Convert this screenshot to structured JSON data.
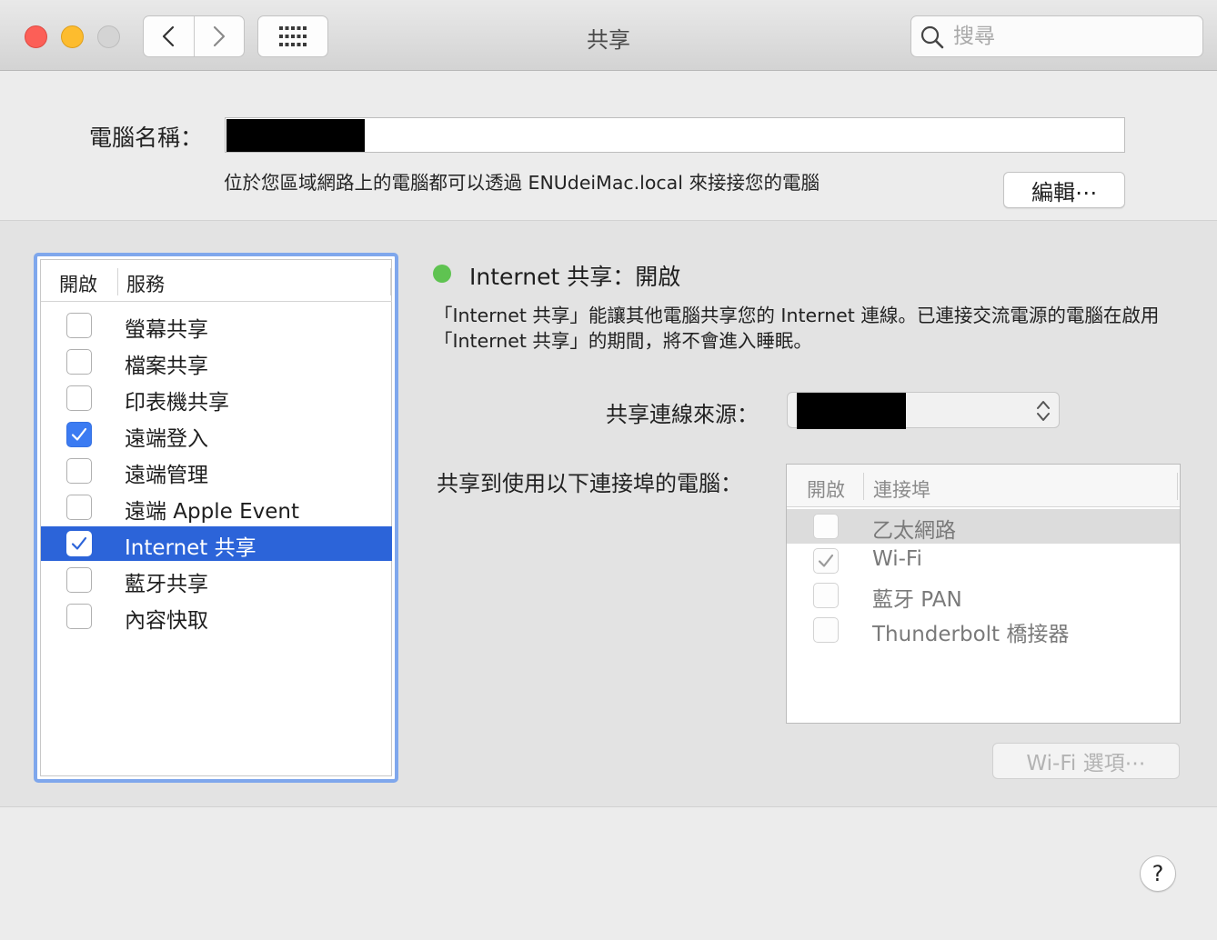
{
  "window": {
    "title": "共享",
    "search_placeholder": "搜尋"
  },
  "computer_name": {
    "label": "電腦名稱：",
    "value": "",
    "description": "位於您區域網路上的電腦都可以透過 ENUdeiMac.local 來接接您的電腦",
    "edit_label": "編輯⋯"
  },
  "services": {
    "header_on": "開啟",
    "header_service": "服務",
    "items": [
      {
        "label": "螢幕共享",
        "checked": false,
        "selected": false
      },
      {
        "label": "檔案共享",
        "checked": false,
        "selected": false
      },
      {
        "label": "印表機共享",
        "checked": false,
        "selected": false
      },
      {
        "label": "遠端登入",
        "checked": true,
        "selected": false
      },
      {
        "label": "遠端管理",
        "checked": false,
        "selected": false
      },
      {
        "label": "遠端 Apple Event",
        "checked": false,
        "selected": false
      },
      {
        "label": "Internet 共享",
        "checked": true,
        "selected": true
      },
      {
        "label": "藍牙共享",
        "checked": false,
        "selected": false
      },
      {
        "label": "內容快取",
        "checked": false,
        "selected": false
      }
    ]
  },
  "detail": {
    "status": "Internet 共享：開啟",
    "status_color": "#5fc351",
    "description": "「Internet 共享」能讓其他電腦共享您的 Internet 連線。已連接交流電源的電腦在啟用「Internet 共享」的期間，將不會進入睡眠。",
    "source_label": "共享連線來源：",
    "source_value": "",
    "ports_label": "共享到使用以下連接埠的電腦：",
    "ports_header_on": "開啟",
    "ports_header_port": "連接埠",
    "ports": [
      {
        "label": "乙太網路",
        "checked": false
      },
      {
        "label": "Wi-Fi",
        "checked": true
      },
      {
        "label": "藍牙 PAN",
        "checked": false
      },
      {
        "label": "Thunderbolt 橋接器",
        "checked": false
      }
    ],
    "wifi_options_label": "Wi-Fi 選項⋯"
  },
  "help_label": "?",
  "colors": {
    "accent": "#2c64d9",
    "focus_ring": "#7fa7ec",
    "close": "#fc5f57",
    "minimize": "#fdbc2e"
  }
}
